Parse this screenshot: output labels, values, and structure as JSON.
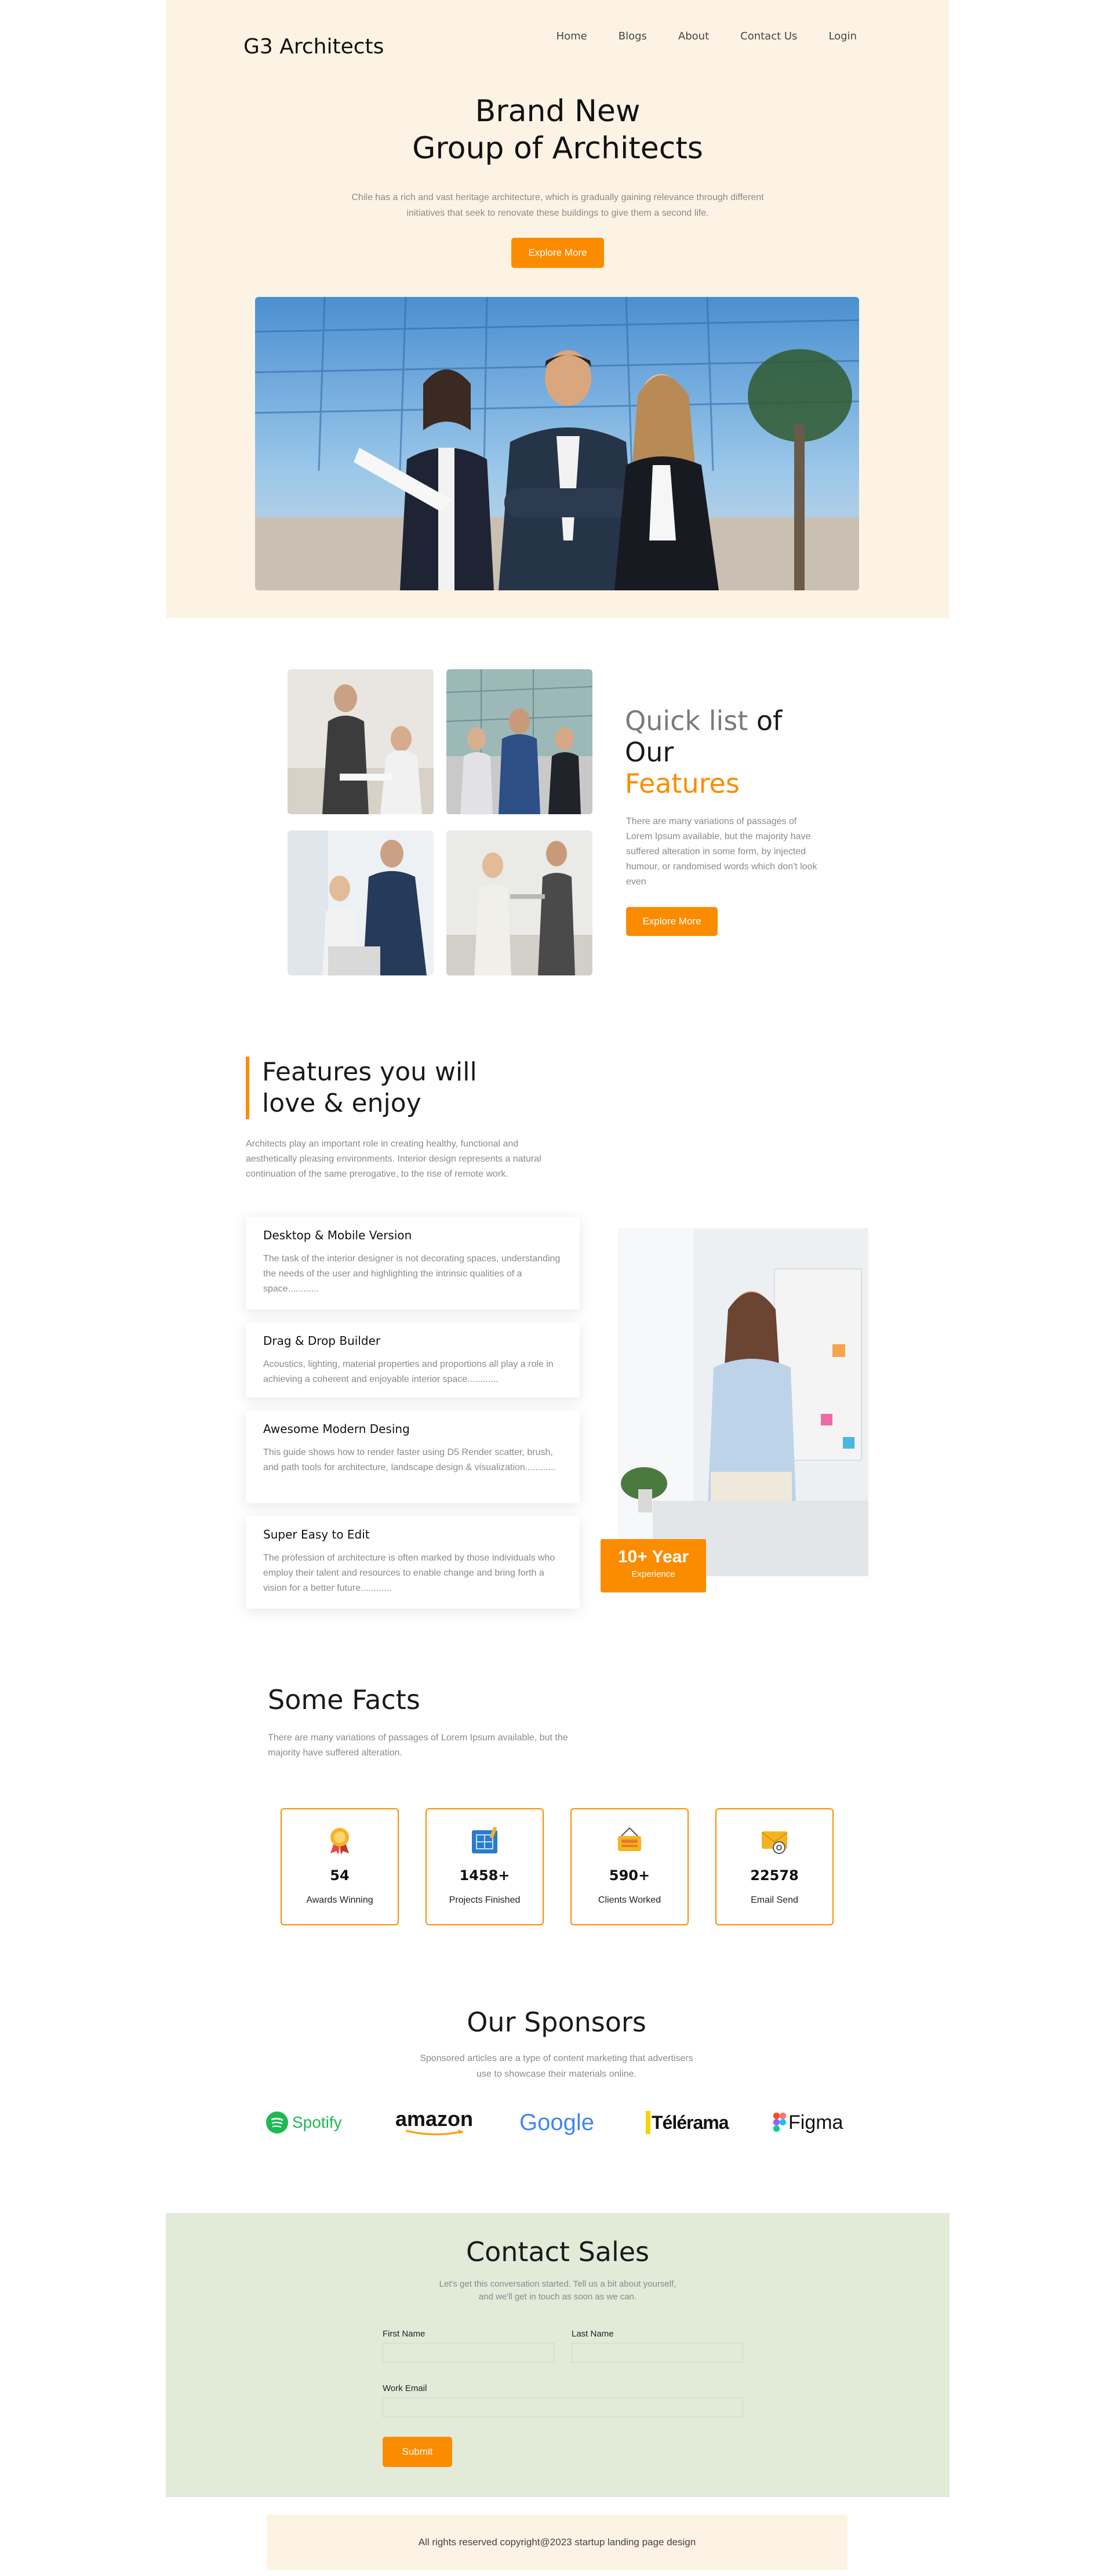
{
  "header": {
    "logo": "G3 Architects",
    "nav": [
      "Home",
      "Blogs",
      "About",
      "Contact Us",
      "Login"
    ]
  },
  "hero": {
    "title_line1": "Brand New",
    "title_line2": "Group of Architects",
    "desc_line1": "Chile has a rich and vast heritage architecture, which is gradually gaining relevance through different",
    "desc_line2": "initiatives that seek to renovate these buildings to give them a second life.",
    "cta": "Explore More"
  },
  "quick_list": {
    "title_part1": "Quick list",
    "title_part2": "of",
    "title_part3": "Our",
    "title_part4": "Features",
    "desc": "There are many variations of passages of Lorem Ipsum available, but the majority have suffered alteration in some form, by injected humour, or randomised words which don't look even",
    "cta": "Explore More"
  },
  "features": {
    "title_line1": "Features you will",
    "title_line2": "love & enjoy",
    "desc": "Architects play an important role in creating healthy, functional and aesthetically pleasing environments. Interior design represents a natural continuation of the same prerogative, to the rise of remote work.",
    "cards": [
      {
        "title": "Desktop & Mobile Version",
        "text": "The task of the interior designer is not decorating spaces, understanding the needs of the user and highlighting the intrinsic qualities of a space............"
      },
      {
        "title": "Drag & Drop Builder",
        "text": "Acoustics, lighting, material properties and proportions all play a role in achieving a coherent and enjoyable interior space............"
      },
      {
        "title": "Awesome Modern Desing",
        "text": "This guide shows how to render faster using D5 Render scatter, brush, and path tools for architecture, landscape design & visualization............"
      },
      {
        "title": "Super Easy to Edit",
        "text": "The profession of architecture is often marked by those individuals who employ their talent and resources to enable change and bring forth a vision for a better future............"
      }
    ],
    "badge_big": "10+ Year",
    "badge_small": "Experience"
  },
  "facts": {
    "title": "Some Facts",
    "desc": "There are many variations of passages of Lorem Ipsum available, but the majority have suffered alteration.",
    "items": [
      {
        "num": "54",
        "label": "Awards Winning",
        "icon": "award-icon"
      },
      {
        "num": "1458+",
        "label": "Projects Finished",
        "icon": "blueprint-icon"
      },
      {
        "num": "590+",
        "label": "Clients Worked",
        "icon": "clients-sign-icon"
      },
      {
        "num": "22578",
        "label": "Email Send",
        "icon": "email-icon"
      }
    ]
  },
  "sponsors": {
    "title": "Our Sponsors",
    "desc_line1": "Sponsored articles are a type of content marketing that advertisers",
    "desc_line2": "use to showcase their materials online.",
    "logos": [
      "Spotify",
      "amazon",
      "Google",
      "Télérama",
      "Figma"
    ]
  },
  "contact": {
    "title": "Contact Sales",
    "desc_line1": "Let's get this conversation started. Tell us a bit about yourself,",
    "desc_line2": "and we'll get in touch as soon as we can.",
    "first_name_label": "First Name",
    "last_name_label": "Last Name",
    "work_email_label": "Work Email",
    "submit": "Submit"
  },
  "footer": {
    "text": "All rights reserved copyright@2023 startup landing page design"
  },
  "colors": {
    "accent": "#fb8c00",
    "hero_bg": "#fdf3e4",
    "contact_bg": "#e2ead8"
  }
}
